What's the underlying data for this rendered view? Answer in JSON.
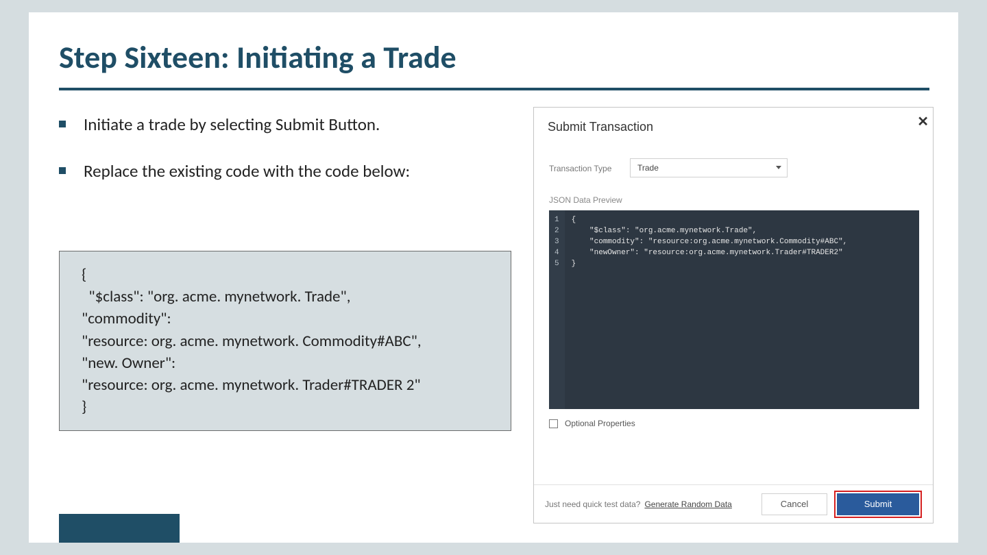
{
  "title": "Step Sixteen: Initiating a Trade",
  "bullets": {
    "b1": "Initiate a trade by selecting Submit Button.",
    "b2": "Replace the existing code with the code below:"
  },
  "code_block": "{\n  \"$class\": \"org. acme. mynetwork. Trade\",\n\"commodity\":\n\"resource: org. acme. mynetwork. Commodity#ABC\",\n\"new. Owner\":\n\"resource: org. acme. mynetwork. Trader#TRADER 2\"\n}",
  "dialog": {
    "title": "Submit Transaction",
    "close": "✕",
    "transaction_type_label": "Transaction Type",
    "transaction_type_value": "Trade",
    "json_preview_label": "JSON Data Preview",
    "editor_lines": [
      "1",
      "2",
      "3",
      "4",
      "5"
    ],
    "editor_code": "{\n    \"$class\": \"org.acme.mynetwork.Trade\",\n    \"commodity\": \"resource:org.acme.mynetwork.Commodity#ABC\",\n    \"newOwner\": \"resource:org.acme.mynetwork.Trader#TRADER2\"\n}",
    "optional_label": "Optional Properties",
    "footer_prompt": "Just need quick test data?",
    "generate_link": "Generate Random Data",
    "cancel_label": "Cancel",
    "submit_label": "Submit"
  }
}
